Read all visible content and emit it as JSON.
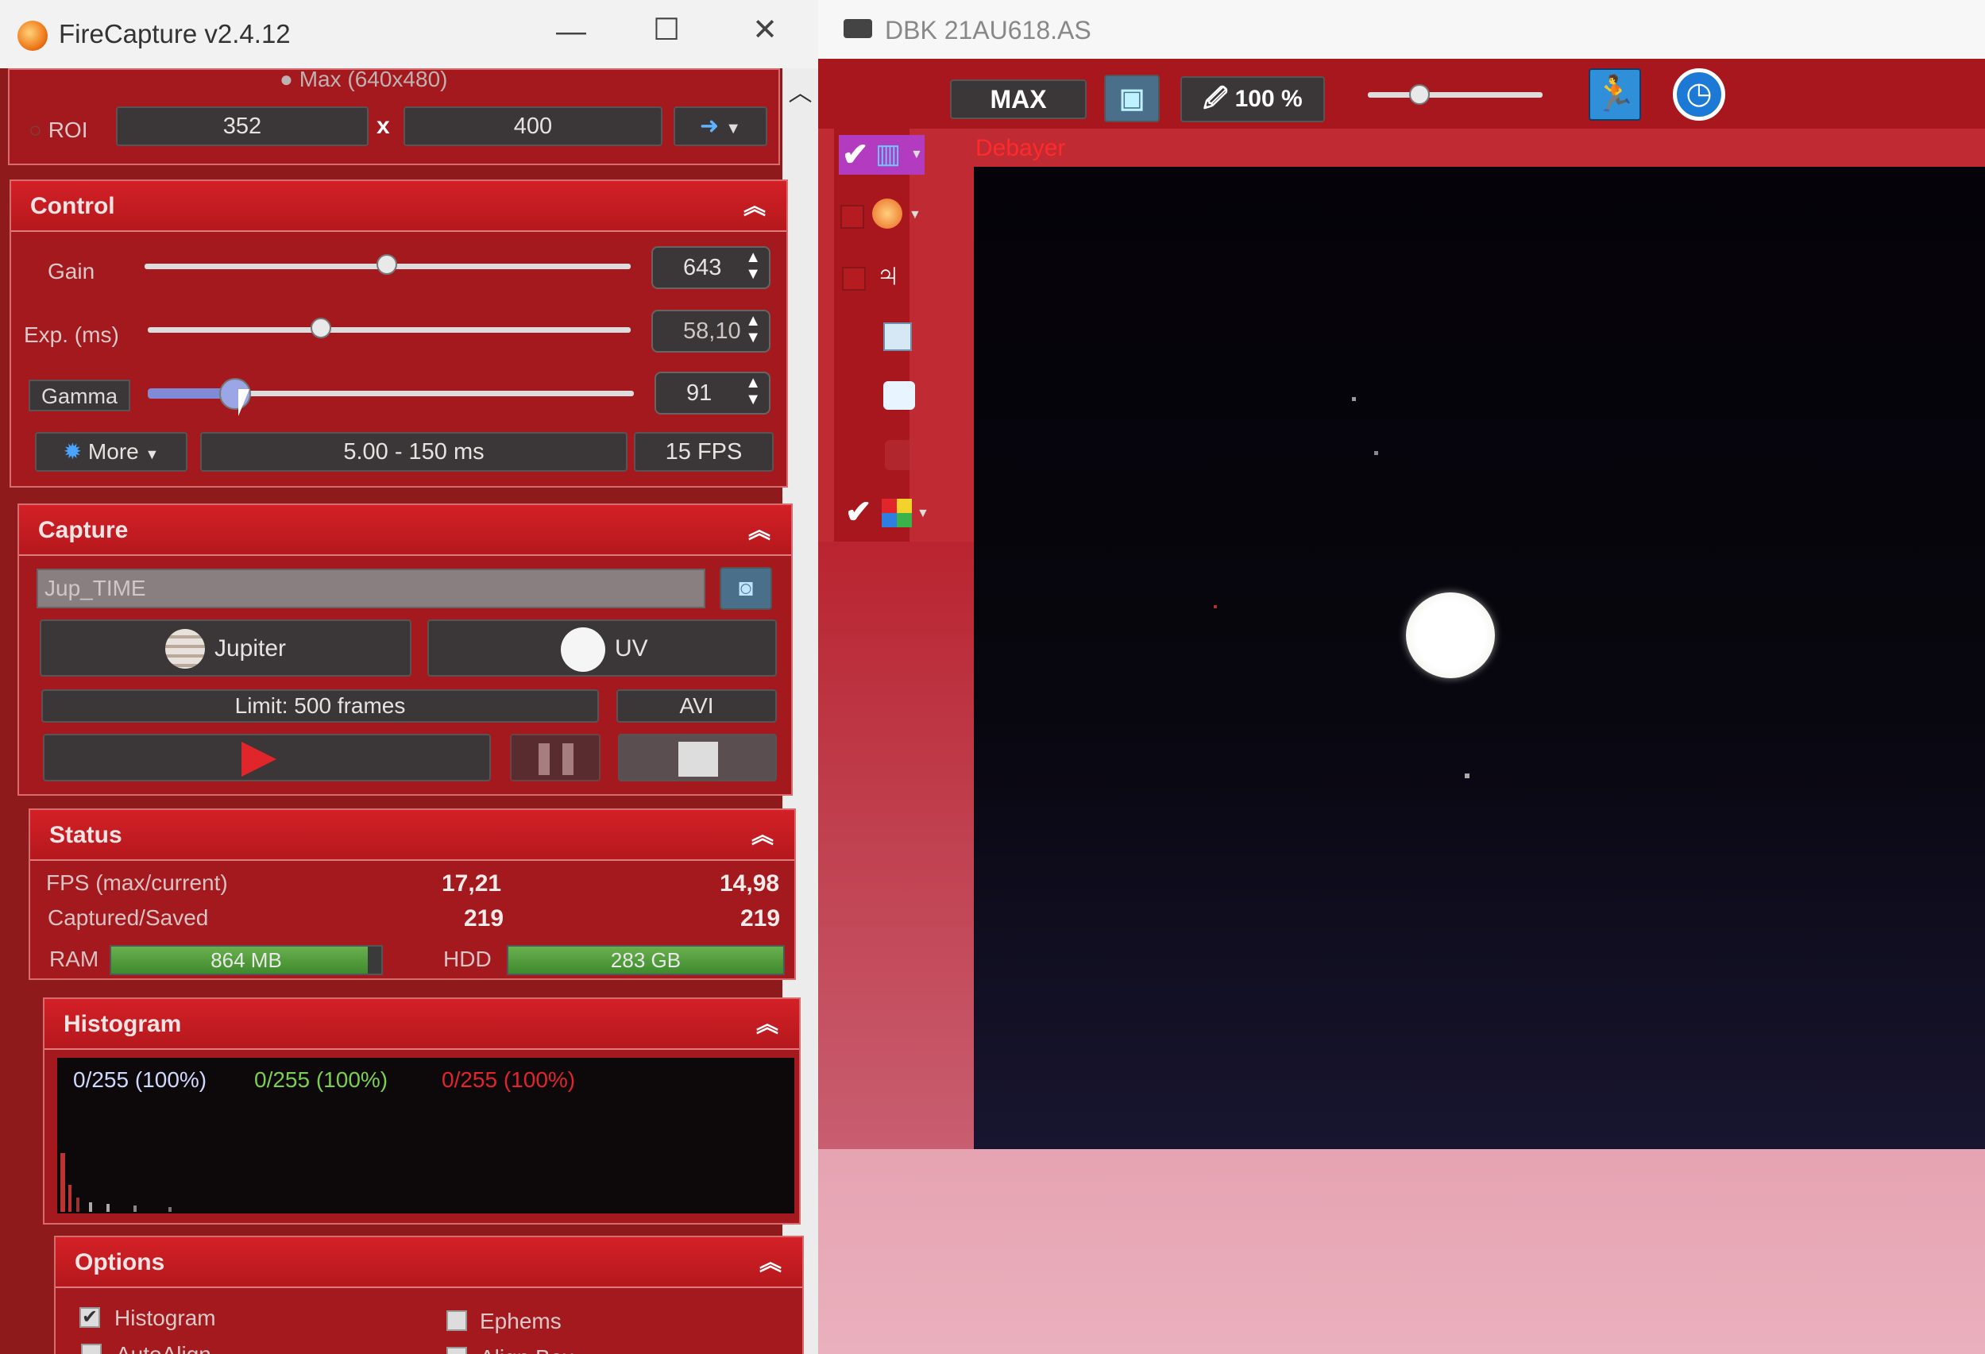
{
  "left_window": {
    "title": "FireCapture v2.4.12",
    "window_buttons": {
      "minimize": "—",
      "maximize": "☐",
      "close": "✕"
    },
    "roi": {
      "mode_label": "Max (640x480)",
      "label": "ROI",
      "width": "352",
      "separator": "x",
      "height": "400"
    },
    "control": {
      "title": "Control",
      "gain": {
        "label": "Gain",
        "value": "643",
        "level": 0.5
      },
      "exposure": {
        "label": "Exp. (ms)",
        "value": "58,10",
        "level": 0.36
      },
      "gamma": {
        "label": "Gamma",
        "value": "91",
        "level": 0.18
      },
      "more_label": "More",
      "range_label": "5.00 - 150 ms",
      "fps_label": "15 FPS"
    },
    "capture": {
      "title": "Capture",
      "name_value": "Jup_TIME",
      "object_label": "Jupiter",
      "filter_label": "UV",
      "limit_label": "Limit: 500 frames",
      "format_label": "AVI"
    },
    "status": {
      "title": "Status",
      "fps_label": "FPS (max/current)",
      "fps_max": "17,21",
      "fps_current": "14,98",
      "captured_label": "Captured/Saved",
      "captured": "219",
      "saved": "219",
      "ram_label": "RAM",
      "ram_value": "864 MB",
      "ram_level": 0.95,
      "hdd_label": "HDD",
      "hdd_value": "283 GB",
      "hdd_level": 1.0
    },
    "histogram": {
      "title": "Histogram",
      "channel_1": "0/255 (100%)",
      "channel_2": "0/255 (100%)",
      "channel_3": "0/255 (100%)",
      "colors": {
        "channel_1": "#cfd8ff",
        "channel_2": "#7ad04e",
        "channel_3": "#e0262b"
      }
    },
    "options": {
      "title": "Options",
      "histogram_label": "Histogram",
      "histogram_checked": true,
      "ephems_label": "Ephems",
      "ephems_checked": false,
      "autoalign_label": "AutoAlign",
      "alignbox_label": "Align Box"
    }
  },
  "right_window": {
    "title": "DBK 21AU618.AS",
    "toolbar": {
      "max_label": "MAX",
      "zoom_label": "100 %",
      "zoom_level": 0.3
    },
    "debayer_label": "Debayer",
    "accent_color": "#bf2a33"
  }
}
